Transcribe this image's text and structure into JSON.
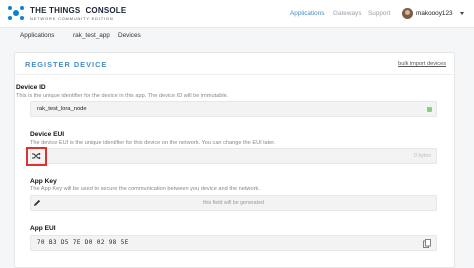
{
  "header": {
    "brand_line1": "THE THINGS",
    "brand_console": "CONSOLE",
    "brand_line2": "NETWORK   COMMUNITY EDITION",
    "nav": [
      "Applications",
      "Gateways",
      "Support"
    ],
    "username": "makoooy123"
  },
  "breadcrumb": {
    "applications": "Applications",
    "sep": "›",
    "app": "rak_test_app",
    "devices": "Devices"
  },
  "card": {
    "title": "REGISTER DEVICE",
    "bulk_link": "bulk import devices"
  },
  "fields": {
    "device_id": {
      "label": "Device ID",
      "help": "This is the unique identifier for the device in this app. The device ID will be immutable.",
      "value": "rak_test_lora_node"
    },
    "device_eui": {
      "label": "Device EUI",
      "help": "The device EUI is the unique identifier for this device on the network. You can change the EUI later.",
      "placeholder": "0 bytes"
    },
    "app_key": {
      "label": "App Key",
      "help": "The App Key will be used to secure the communication between you device and the network.",
      "placeholder": "this field will be generated"
    },
    "app_eui": {
      "label": "App EUI",
      "value": "70 B3 D5 7E D0 02 98 5E"
    }
  },
  "colors": {
    "accent": "#4a8ec9",
    "focus_border": "#e03131",
    "valid": "#7ed47e"
  },
  "icons": [
    "ttn-logo-icon",
    "shuffle-icon",
    "pencil-icon",
    "copy-icon",
    "chevron-down-icon"
  ]
}
